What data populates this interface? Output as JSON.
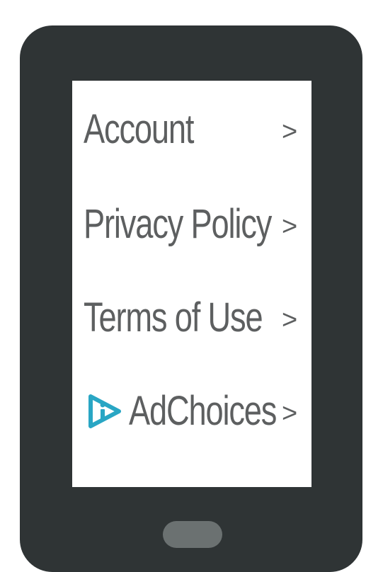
{
  "menu": {
    "items": [
      {
        "label": "Account",
        "chevron": ">"
      },
      {
        "label": "Privacy Policy",
        "chevron": ">"
      },
      {
        "label": "Terms of Use",
        "chevron": ">"
      },
      {
        "label": "AdChoices",
        "chevron": ">",
        "icon": "adchoices-icon"
      }
    ]
  },
  "colors": {
    "device_body": "#2f3435",
    "screen": "#ffffff",
    "text": "#5d5f60",
    "adchoices_accent": "#29a6c4",
    "home_button": "#6b7171"
  }
}
